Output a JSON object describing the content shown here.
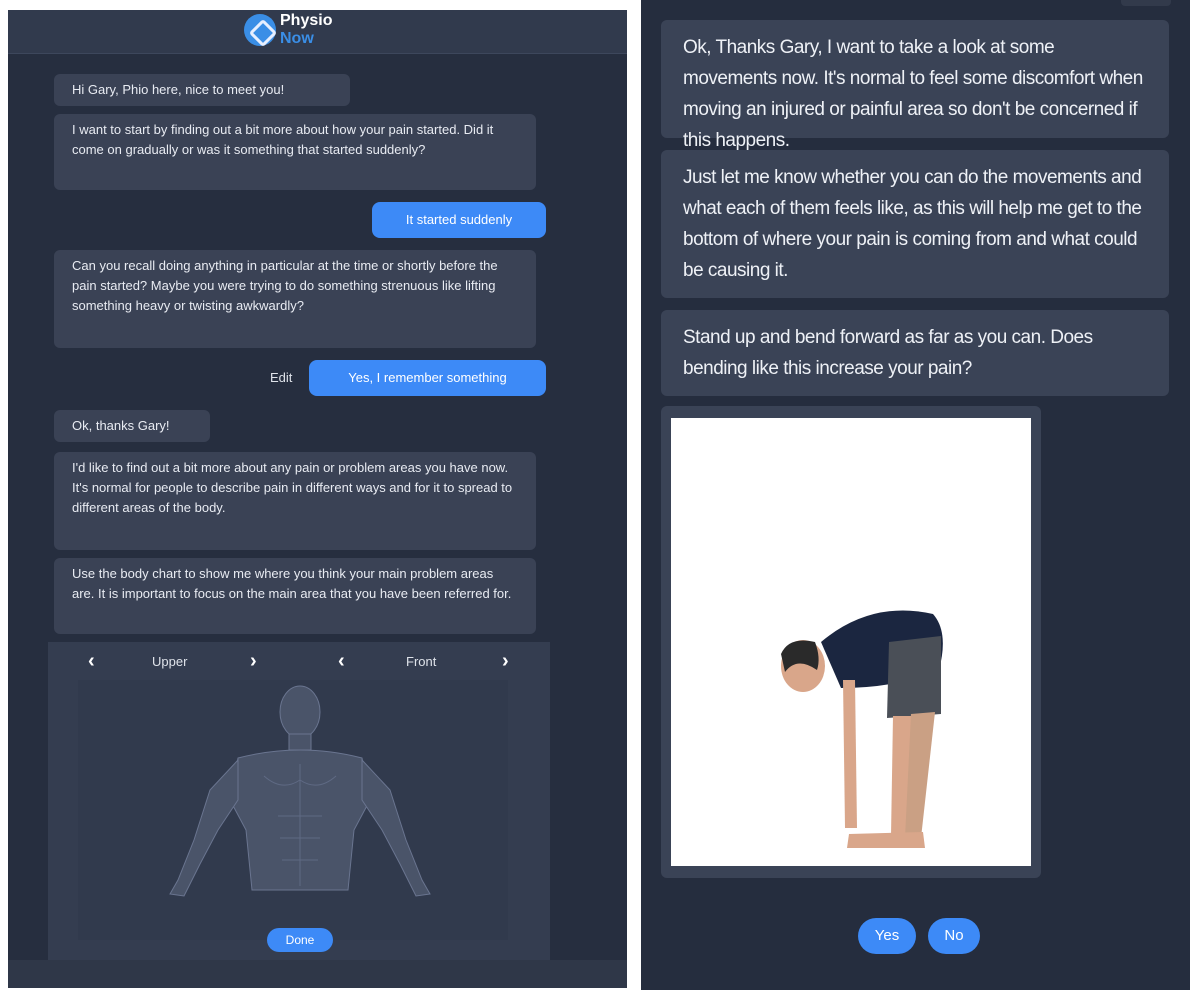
{
  "app": {
    "logo_top": "Physio",
    "logo_bottom": "Now"
  },
  "left_chat": {
    "messages": [
      "Hi Gary, Phio here, nice to meet you!",
      "I want to start by finding out a bit more about how your pain started. Did it come on gradually or was it something that started suddenly?",
      "Can you recall doing anything in particular at the time or shortly before the pain started? Maybe you were trying to do something strenuous like lifting something heavy or twisting awkwardly?",
      "Ok, thanks Gary!",
      "I'd like to find out a bit more about any pain or problem areas you have now. It's normal for people to describe pain in different ways and for it to spread to different areas of the body.",
      "Use the body chart to show me where you think your main problem areas are. It is important to focus on the main area that you have been referred for."
    ],
    "user_replies": [
      "It started suddenly",
      "Yes, I remember something"
    ],
    "edit_label": "Edit"
  },
  "body_chart": {
    "region_label": "Upper",
    "view_label": "Front",
    "done_label": "Done"
  },
  "right_chat": {
    "messages": [
      "Ok, Thanks Gary, I want to take a look at some movements now. It's normal to feel some discomfort when moving an injured or painful area so don't be concerned if this happens.",
      "Just let me know whether you can do the movements and what each of them feels like, as this will help me get to the bottom of where your pain is coming from and what could be causing it.",
      "Stand up and bend forward as far as you can. Does bending like this increase your pain?"
    ],
    "yes_label": "Yes",
    "no_label": "No"
  },
  "colors": {
    "background": "#262e3f",
    "bot_bubble": "#3a4255",
    "user_bubble": "#3d8af7",
    "brand_blue": "#3a8ee6"
  }
}
